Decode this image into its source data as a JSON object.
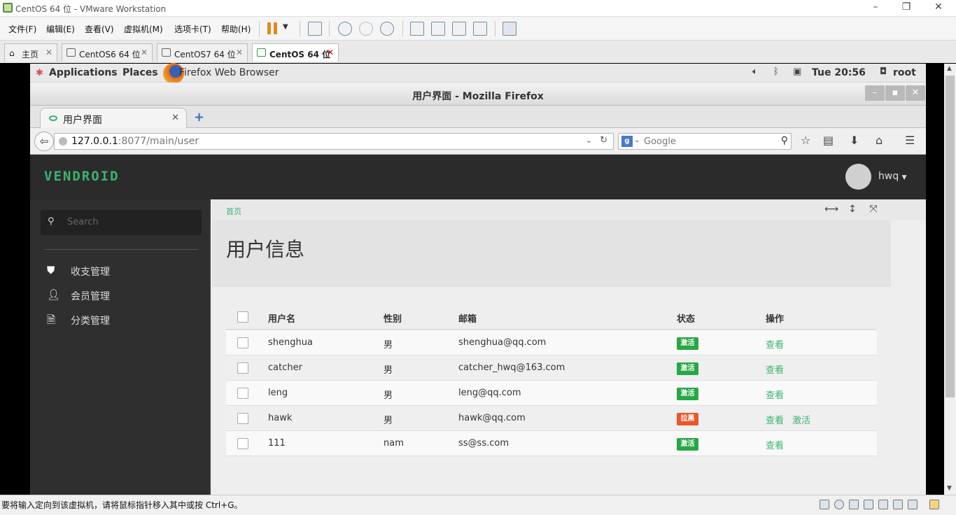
{
  "vmware": {
    "window_title": "CentOS 64 位 - VMware Workstation",
    "menus": [
      "文件(F)",
      "编辑(E)",
      "查看(V)",
      "虚拟机(M)",
      "选项卡(T)",
      "帮助(H)"
    ],
    "tabs": [
      {
        "label": "主页"
      },
      {
        "label": "CentOS6 64 位"
      },
      {
        "label": "CentOS7 64 位"
      },
      {
        "label": "CentOS 64 位"
      }
    ],
    "status_text": "要将输入定向到该虚拟机，请将鼠标指针移入其中或按 Ctrl+G。"
  },
  "gnome": {
    "applications": "Applications",
    "places": "Places",
    "running_app": "Firefox Web Browser",
    "clock": "Tue 20:56",
    "user": "root"
  },
  "firefox": {
    "window_title": "用户界面 - Mozilla Firefox",
    "tab_label": "用户界面",
    "url_host": "127.0.0.1",
    "url_rest": ":8077/main/user",
    "search_placeholder": "Google"
  },
  "app": {
    "brand": "VENDROID",
    "username": "hwq",
    "search_placeholder": "Search",
    "sidebar": [
      {
        "label": "收支管理",
        "icon": "shield-icon"
      },
      {
        "label": "会员管理",
        "icon": "user-icon"
      },
      {
        "label": "分类管理",
        "icon": "file-icon"
      }
    ],
    "breadcrumb": "首页",
    "page_title": "用户信息",
    "table": {
      "headers": [
        "用户名",
        "性别",
        "邮箱",
        "状态",
        "操作"
      ],
      "rows": [
        {
          "username": "shenghua",
          "gender": "男",
          "email": "shenghua@qq.com",
          "status": "激活",
          "actions": [
            "查看"
          ]
        },
        {
          "username": "catcher",
          "gender": "男",
          "email": "catcher_hwq@163.com",
          "status": "激活",
          "actions": [
            "查看"
          ]
        },
        {
          "username": "leng",
          "gender": "男",
          "email": "leng@qq.com",
          "status": "激活",
          "actions": [
            "查看"
          ]
        },
        {
          "username": "hawk",
          "gender": "男",
          "email": "hawk@qq.com",
          "status": "拉黑",
          "actions": [
            "查看",
            "激活"
          ]
        },
        {
          "username": "111",
          "gender": "nam",
          "email": "ss@ss.com",
          "status": "激活",
          "actions": [
            "查看"
          ]
        }
      ]
    }
  },
  "colors": {
    "accent_green": "#3cb371",
    "status_active": "#28a745",
    "status_blocked": "#e8562a",
    "nav_dark": "#2b2b2b"
  }
}
